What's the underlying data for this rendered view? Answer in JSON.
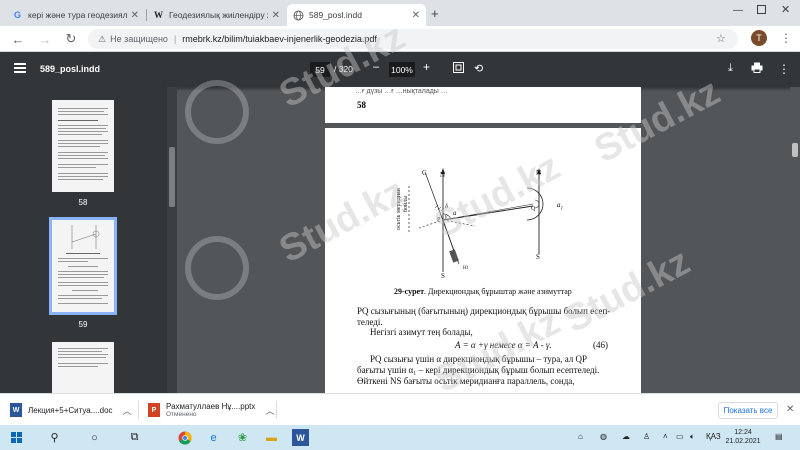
{
  "tabs": [
    {
      "title": "кері және тура геодезиялық е",
      "favicon": "google-g-icon"
    },
    {
      "title": "Геодезиялық жиілендіру жане",
      "favicon": "wikipedia-w-icon"
    },
    {
      "title": "589_posl.indd",
      "favicon": "globe-icon"
    }
  ],
  "new_tab": "+",
  "address": {
    "security": "Не защищено",
    "url": "rmebrk.kz/bilim/tuiakbaev-injenerlik-geodezia.pdf"
  },
  "profile_initial": "T",
  "pdf": {
    "filename": "589_posl.indd",
    "page_current": "59",
    "page_total": "/ 320",
    "zoom": "100%",
    "zoom_minus": "–",
    "zoom_plus": "+"
  },
  "thumbnails": [
    {
      "label": "58"
    },
    {
      "label": "59"
    }
  ],
  "page58": {
    "footer_line": "…ғ дүзы …ғ …нықталады …",
    "number": "58"
  },
  "page59": {
    "figure_labels": {
      "c": "C",
      "n_left": "N",
      "n_right": "N",
      "s_left": "S",
      "s_right": "S",
      "meridian": "осьтік меридиан",
      "boliny": "бойлы",
      "a": "a",
      "a1": "a",
      "a1_sub": "1",
      "gamma": "γ",
      "delta": "δ",
      "p": "P",
      "q": "Q",
      "yu": "Ю"
    },
    "caption_bold": "29-сурет",
    "caption_rest": ". Дирекциондық бұрыштар және азимуттар",
    "line1": "PQ сызығының (бағытының) дирекциондық бұрышы болып есеп-",
    "line2": "теледі.",
    "line3": "Негізгі азимут тең болады,",
    "formula": "A = α +γ  немесе α = A - γ.",
    "eq_number": "(46)",
    "line4": "PQ сызығы үшін α дирекциондық бұрышы – тура, ал QP",
    "line5": "бағыты үшін α₁ – кері дирекциондық бұрыш болып есептеледі.",
    "line6": "Өйткені NS бағыты осьтік меридианға параллель, сонда,"
  },
  "watermark": "Stud.kz",
  "downloads": [
    {
      "name": "Лекция+5+Ситуа....doc",
      "sub": "",
      "icon": "word-doc-icon",
      "color": "#2b579a"
    },
    {
      "name": "Рахматуллаев Нұ....pptx",
      "sub": "Отменено",
      "icon": "powerpoint-icon",
      "color": "#d04423"
    }
  ],
  "show_all": "Показать все",
  "taskbar": {
    "lang": "ҚАЗ",
    "time": "12:24",
    "date": "21.02.2021"
  }
}
